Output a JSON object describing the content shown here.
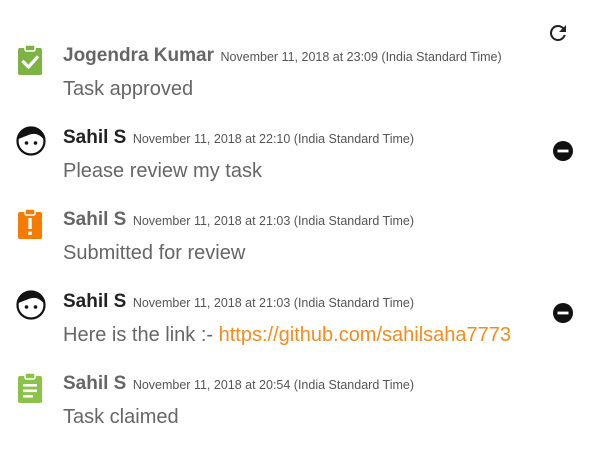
{
  "refresh_icon": "refresh-icon",
  "colors": {
    "approved": "#7cb342",
    "review": "#f57c00",
    "claimed": "#8bc34a",
    "link": "#f28c1e",
    "author_dark": "#222222",
    "author_gray": "#666666"
  },
  "entries": [
    {
      "icon": "clipboard-check-icon",
      "author": "Jogendra Kumar",
      "time": "November 11, 2018 at 23:09 (India Standard Time)",
      "message": "Task approved"
    },
    {
      "icon": "user-avatar-icon",
      "author": "Sahil S",
      "time": "November 11, 2018 at 22:10 (India Standard Time)",
      "message": "Please review my task",
      "action_icon": "remove-circle-icon"
    },
    {
      "icon": "clipboard-alert-icon",
      "author": "Sahil S",
      "time": "November 11, 2018 at 21:03 (India Standard Time)",
      "message": "Submitted for review"
    },
    {
      "icon": "user-avatar-icon",
      "author": "Sahil S",
      "time": "November 11, 2018 at 21:03 (India Standard Time)",
      "message": "Here is the link :- ",
      "link": "https://github.com/sahilsaha7773",
      "action_icon": "remove-circle-icon"
    },
    {
      "icon": "clipboard-text-icon",
      "author": "Sahil S",
      "time": "November 11, 2018 at 20:54 (India Standard Time)",
      "message": "Task claimed"
    }
  ]
}
